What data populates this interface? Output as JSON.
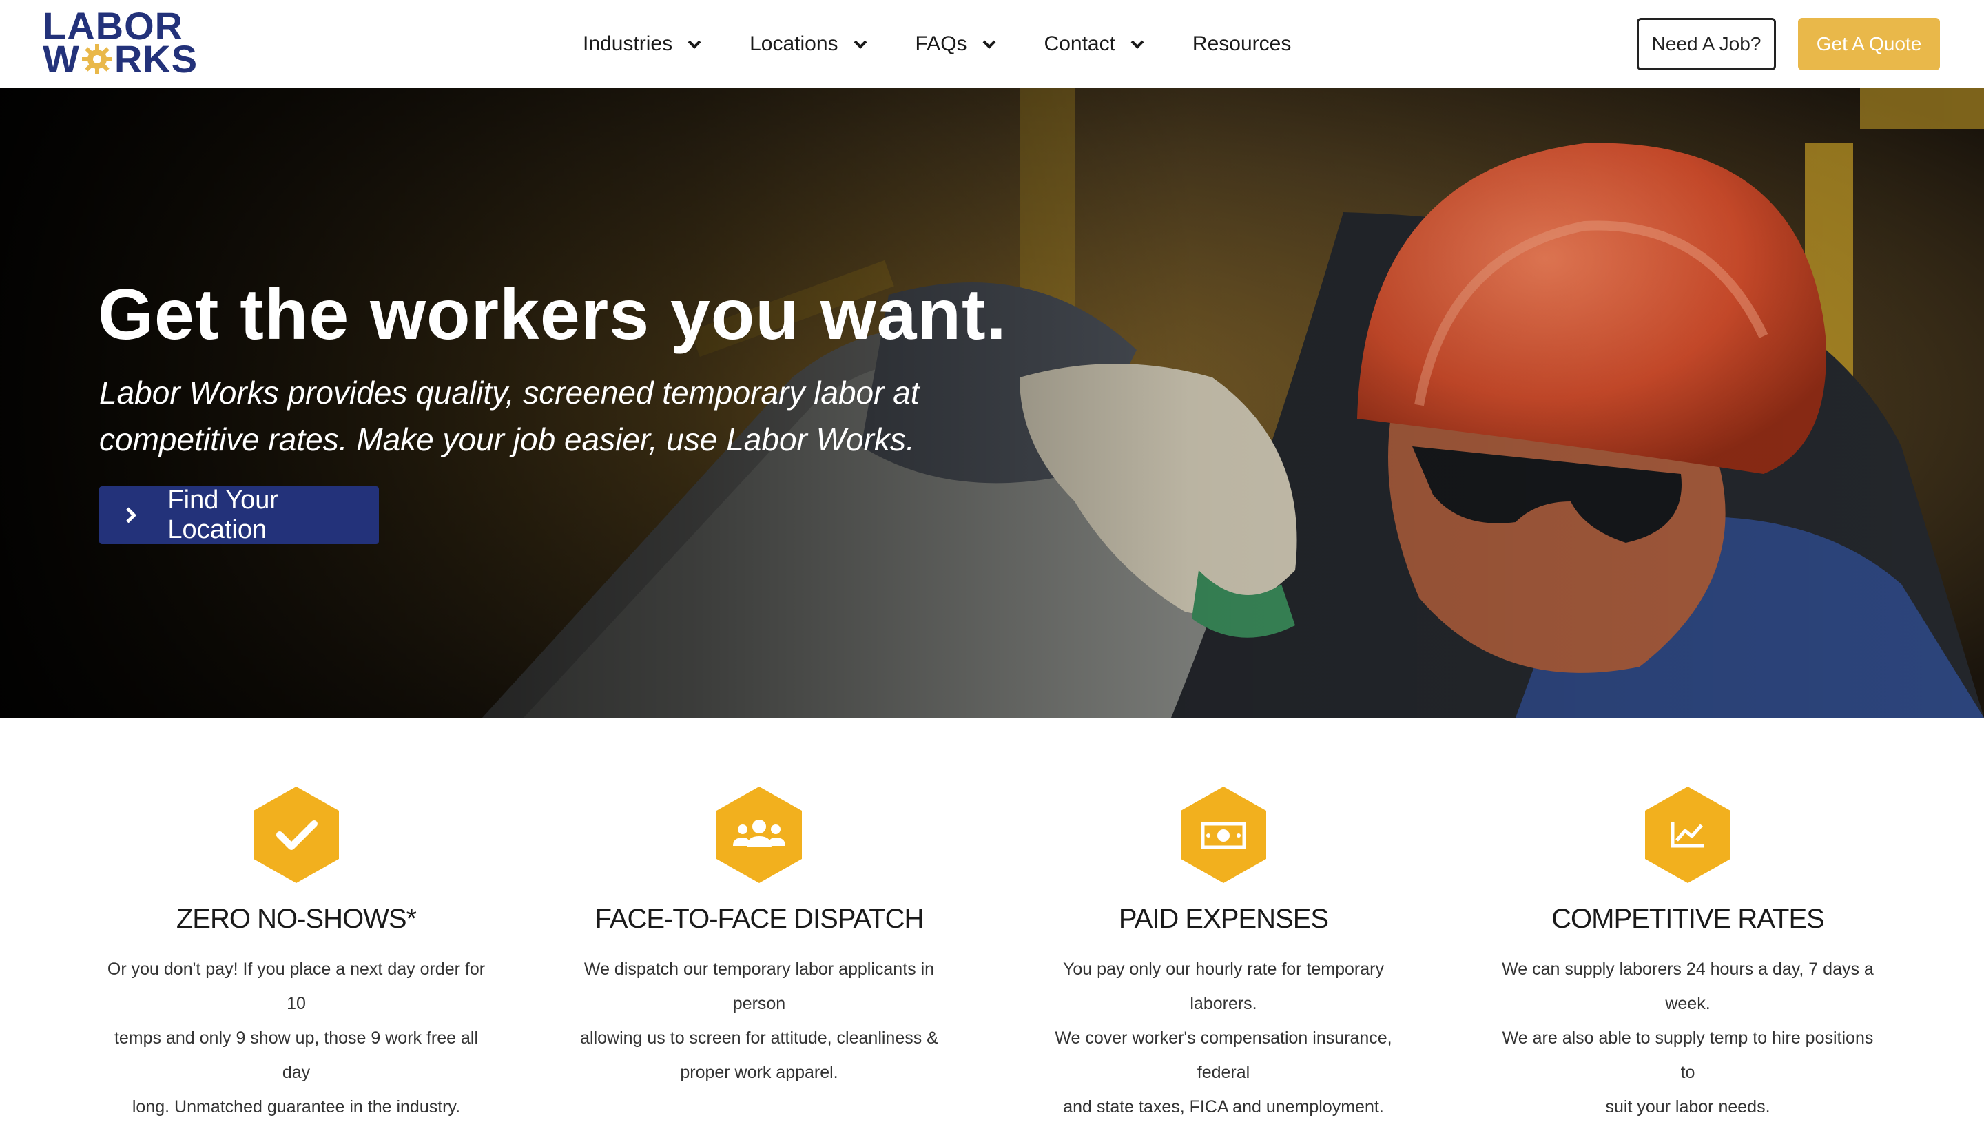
{
  "brand": {
    "logo_top": "LABOR",
    "logo_bottom_left": "W",
    "logo_bottom_right": "RKS",
    "primary_color": "#23327a",
    "accent_color": "#e9b84a"
  },
  "nav": {
    "items": [
      {
        "label": "Industries",
        "has_dropdown": true
      },
      {
        "label": "Locations",
        "has_dropdown": true
      },
      {
        "label": "FAQs",
        "has_dropdown": true
      },
      {
        "label": "Contact",
        "has_dropdown": true
      },
      {
        "label": "Resources",
        "has_dropdown": false
      }
    ],
    "need_job_label": "Need A Job?",
    "get_quote_label": "Get A Quote"
  },
  "hero": {
    "title": "Get the workers you want.",
    "subtitle_line1": "Labor Works provides quality, screened temporary labor at",
    "subtitle_line2": "competitive rates. Make your job easier, use Labor Works.",
    "cta_label": "Find Your Location"
  },
  "features": [
    {
      "icon": "checkmark-icon",
      "title": "ZERO NO-SHOWS*",
      "lines": [
        "Or you don't pay! If you place a next day order for 10",
        "temps and only 9 show up, those 9 work free all day",
        "long. Unmatched guarantee in the industry."
      ]
    },
    {
      "icon": "users-icon",
      "title": "FACE-TO-FACE DISPATCH",
      "lines": [
        "We dispatch our temporary labor applicants in person",
        "allowing us to screen for attitude, cleanliness &",
        "proper work apparel."
      ]
    },
    {
      "icon": "money-bill-icon",
      "title": "PAID EXPENSES",
      "lines": [
        "You pay only our hourly rate for temporary laborers.",
        "We cover worker's compensation insurance, federal",
        "and state taxes, FICA and unemployment."
      ]
    },
    {
      "icon": "chart-line-icon",
      "title": "COMPETITIVE RATES",
      "lines": [
        "We can supply laborers 24 hours a day, 7 days a week.",
        "We are also able to supply temp to hire positions to",
        "suit your labor needs."
      ]
    }
  ]
}
